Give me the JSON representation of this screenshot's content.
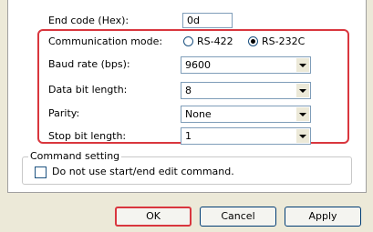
{
  "end_code": {
    "label": "End code (Hex):",
    "value": "0d"
  },
  "communication_mode": {
    "label": "Communication mode:",
    "options": [
      {
        "label": "RS-422",
        "selected": false
      },
      {
        "label": "RS-232C",
        "selected": true
      }
    ]
  },
  "baud_rate": {
    "label": "Baud rate (bps):",
    "value": "9600"
  },
  "data_bit_length": {
    "label": "Data bit length:",
    "value": "8"
  },
  "parity": {
    "label": "Parity:",
    "value": "None"
  },
  "stop_bit_length": {
    "label": "Stop bit length:",
    "value": "1"
  },
  "command_setting": {
    "title": "Command setting",
    "checkbox_label": "Do not use start/end edit command.",
    "checked": false
  },
  "buttons": {
    "ok": "OK",
    "cancel": "Cancel",
    "apply": "Apply"
  },
  "colors": {
    "highlight": "#d9363e",
    "dialog_bg": "#ece9d8",
    "input_border": "#7f9db9"
  }
}
